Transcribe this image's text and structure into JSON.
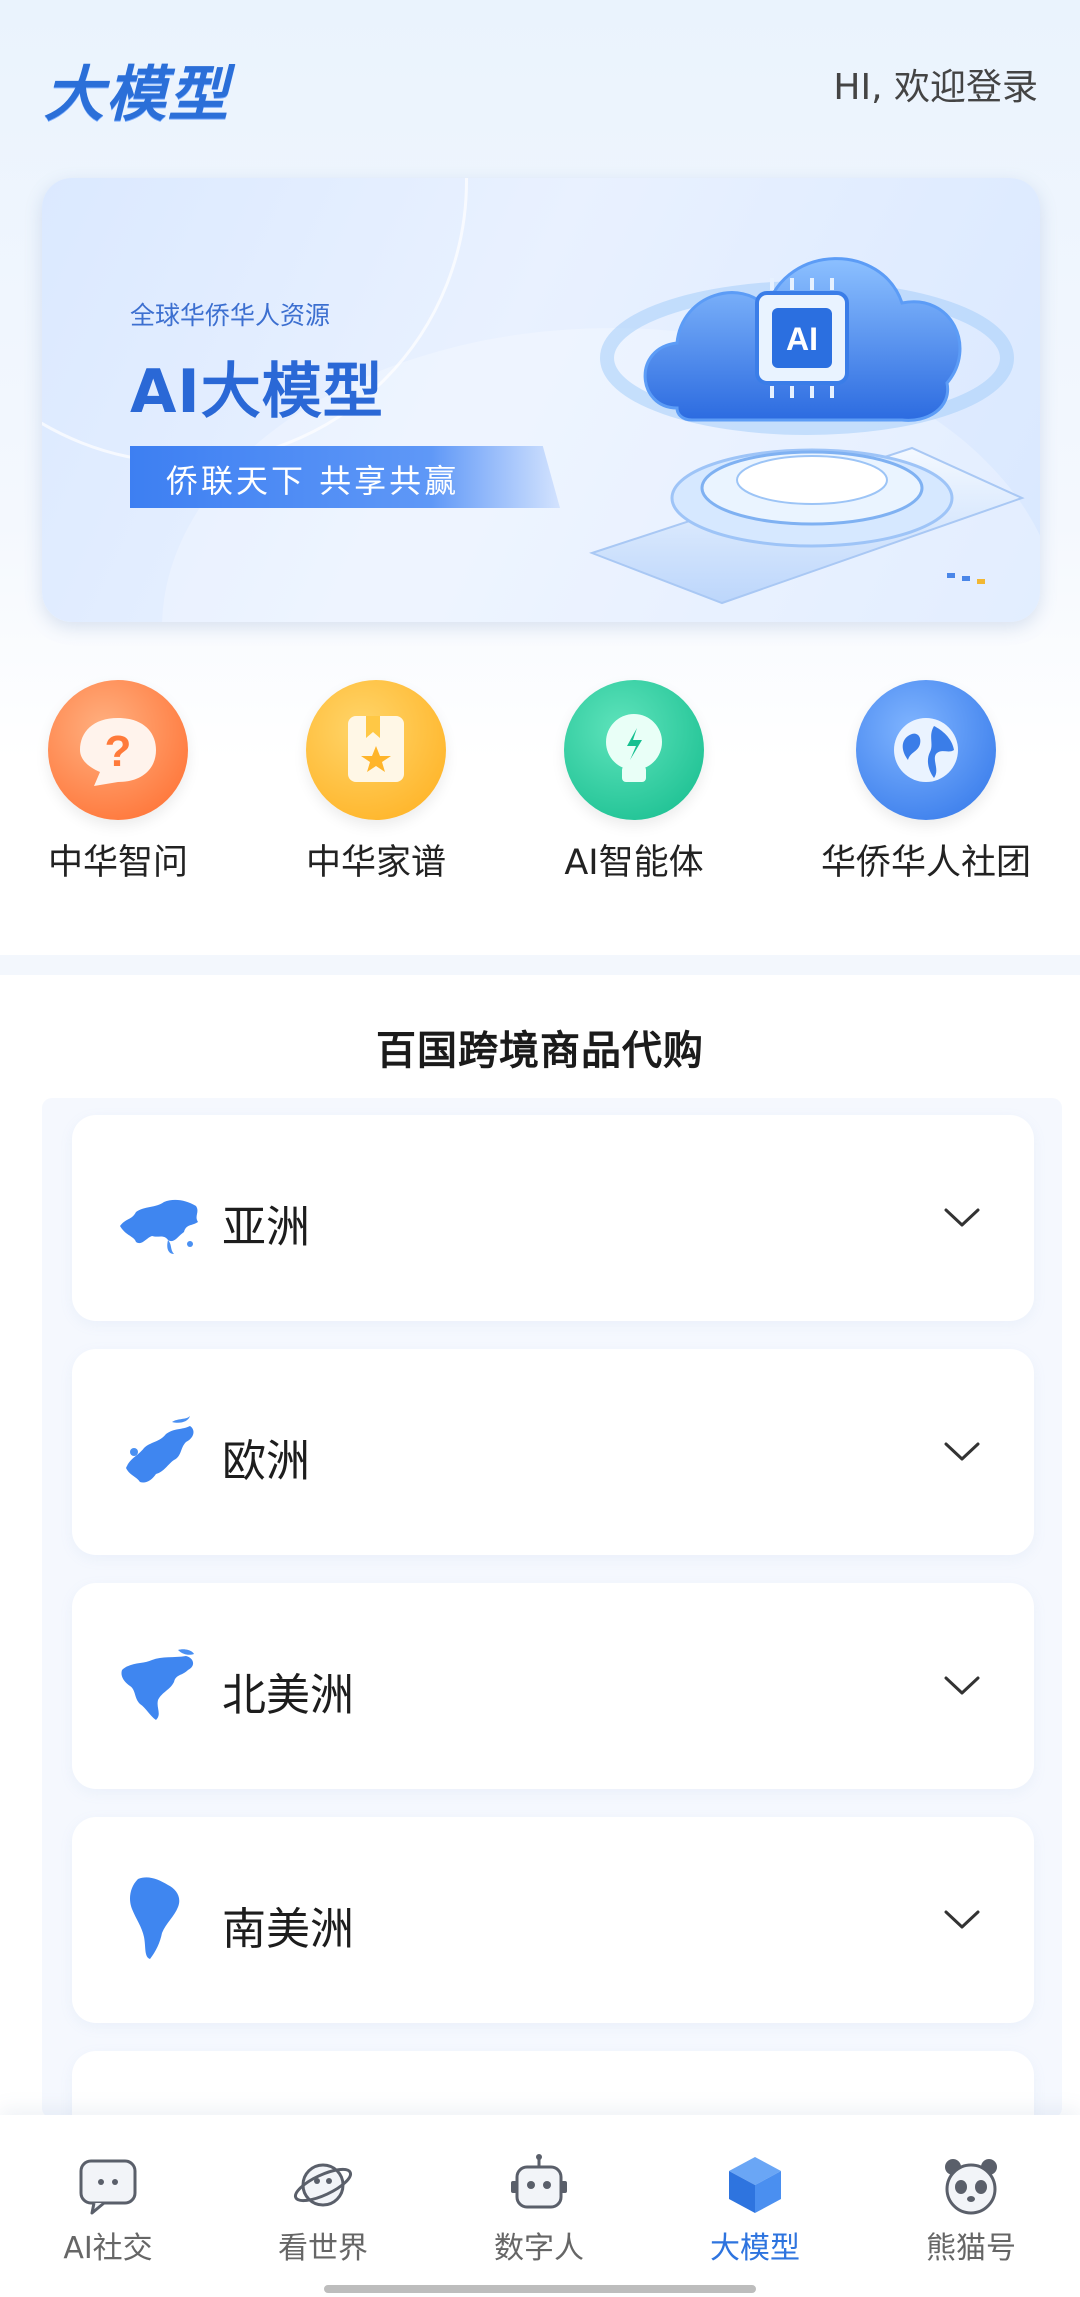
{
  "header": {
    "logo": "大模型",
    "login": "HI, 欢迎登录"
  },
  "banner": {
    "subtitle": "全球华侨华人资源",
    "title": "AI大模型",
    "slogan": "侨联天下  共享共赢",
    "art_chip_text": "AI"
  },
  "quick_actions": [
    {
      "label": "中华智问",
      "icon": "question-bubble-icon",
      "color": "#ff7b3d"
    },
    {
      "label": "中华家谱",
      "icon": "family-book-icon",
      "color": "#ffbe33"
    },
    {
      "label": "AI智能体",
      "icon": "lightbulb-icon",
      "color": "#19c79a"
    },
    {
      "label": "华侨华人社团",
      "icon": "globe-icon",
      "color": "#3f86f0"
    }
  ],
  "section": {
    "title": "百国跨境商品代购",
    "continents": [
      {
        "name": "亚洲",
        "icon": "asia-map-icon"
      },
      {
        "name": "欧洲",
        "icon": "europe-map-icon"
      },
      {
        "name": "北美洲",
        "icon": "north-america-map-icon"
      },
      {
        "name": "南美洲",
        "icon": "south-america-map-icon"
      }
    ]
  },
  "nav": {
    "items": [
      {
        "label": "AI社交",
        "icon": "chat-bubble-icon"
      },
      {
        "label": "看世界",
        "icon": "planet-icon"
      },
      {
        "label": "数字人",
        "icon": "robot-icon"
      },
      {
        "label": "大模型",
        "icon": "cube-icon",
        "active": true
      },
      {
        "label": "熊猫号",
        "icon": "panda-icon"
      }
    ],
    "active_color": "#2e74df"
  }
}
